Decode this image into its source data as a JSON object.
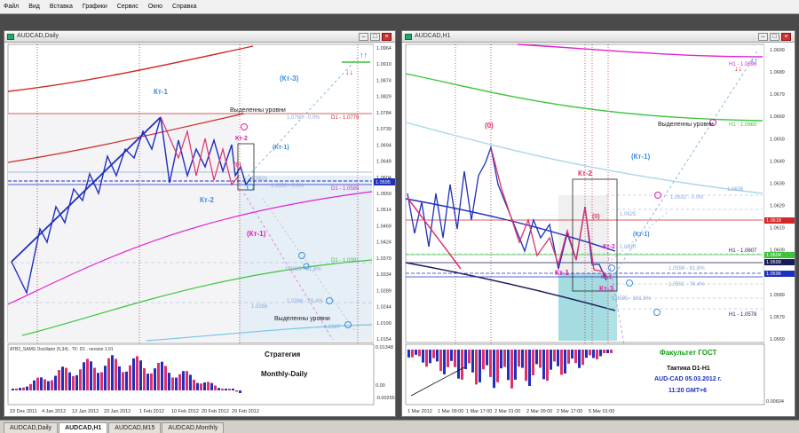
{
  "menu": [
    "Файл",
    "Вид",
    "Вставка",
    "Графики",
    "Сервис",
    "Окно",
    "Справка"
  ],
  "left": {
    "title": "AUDCAD,Daily",
    "price_axis": [
      "1.0964",
      "1.0919",
      "1.0874",
      "1.0829",
      "1.0784",
      "1.0739",
      "1.0694",
      "1.0649",
      "1.0604",
      "1.0559",
      "1.0514",
      "1.0469",
      "1.0424",
      "1.0379",
      "1.0334",
      "1.0289",
      "1.0244",
      "1.0199",
      "1.0154"
    ],
    "price_marker": "1.0595",
    "date_axis": [
      "23 Dec 2011",
      "4 Jan 2012",
      "13 Jan 2012",
      "23 Jan 2012",
      "1 Feb 2012",
      "10 Feb 2012",
      "20 Feb 2012",
      "29 Feb 2012"
    ],
    "labels": {
      "kt1": "Кт-1",
      "kt3p": "(Кт-3)",
      "kt1p": "(Кт-1)",
      "kt2": "Кт-2",
      "kt2b": "Кт-2",
      "zero": "(0)",
      "kt1p2": "(Кт-1)",
      "vyd1": "Выделенны уровни",
      "vyd2": "Выделенны уровни",
      "d1a": "D1 - 1.0779",
      "d1b": "D1 - 1.0585",
      "d1c": "D1 - 1.0391",
      "f0a": "1.0780 - 0.0%",
      "f0b": "1.0621",
      "f0c": "1.0395 - 61.8%",
      "f0d": "1.0266 - 76.4%",
      "f0e": "1.0266",
      "f0f": "1.0600 - 0.0%",
      "f0g": "1.0187"
    },
    "osc": {
      "title": "ATB2_SAMS Oscillator (5,34) . TF: D1 . version 1.01",
      "axis": [
        "0.01348",
        "0.00",
        "-0.00255"
      ],
      "strategy": "Стратегия",
      "strategy2": "Monthly-Daily"
    }
  },
  "right": {
    "title": "AUDCAD,H1",
    "price_axis": [
      "1.0699",
      "1.0689",
      "1.0679",
      "1.0669",
      "1.0659",
      "1.0649",
      "1.0639",
      "1.0629",
      "1.0619",
      "1.0609",
      "1.0599",
      "1.0589",
      "1.0579",
      "1.0569"
    ],
    "price_marker_a": "1.0618",
    "price_marker_b": "1.0604",
    "price_marker_c": "1.0599",
    "price_marker_d": "1.0596",
    "date_axis": [
      "1 Mar 2012",
      "1 Mar 09:00",
      "1 Mar 17:00",
      "2 Mar 01:00",
      "2 Mar 09:00",
      "2 Mar 17:00",
      "5 Mar 01:00"
    ],
    "labels": {
      "zero": "(0)",
      "kt2": "Кт-2",
      "kt1p": "(Кт-1)",
      "zero2": "(0)",
      "kt1p2": "(Кт-1)",
      "kt2b": "Кт-2",
      "kt1": "Кт-1",
      "kt1b": "Кт-1",
      "kt3": "Кт-3",
      "vyd": "Выделенны уровни",
      "h1a": "H1 - 1.0665",
      "h1b": "H1 - 1.0607",
      "h1c": "H1 - 1.0578",
      "h1d": "H1 - 1.0696",
      "f1": "1.0625",
      "f2": "1.0632 - 0.0%",
      "f3": "1.0610",
      "f4": "1.0598 - 61.8%",
      "f5": "1.0591 - 76.4%",
      "f6": "1.0585 - 161.8%",
      "f7": "1.0636"
    },
    "osc": {
      "axis": [
        "0.00604"
      ],
      "faculty": "Факультет ГОСТ",
      "tactic": "Тактика D1-H1",
      "pair": "AUD-CAD 05.03.2012 г.",
      "time": "11:20 GMT+6"
    }
  },
  "tabs": [
    "AUDCAD,Daily",
    "AUDCAD,H1",
    "AUDCAD,M15",
    "AUDCAD,Monthly"
  ],
  "colors": {
    "bull": "#1f2fbf",
    "bear": "#e0306a",
    "kt_blue": "#3a8fe0",
    "pink_label": "#e020b0",
    "green_line": "#3cc43c",
    "red_line": "#d02828",
    "magenta_line": "#e020d0",
    "faculty_green": "#12a012"
  }
}
